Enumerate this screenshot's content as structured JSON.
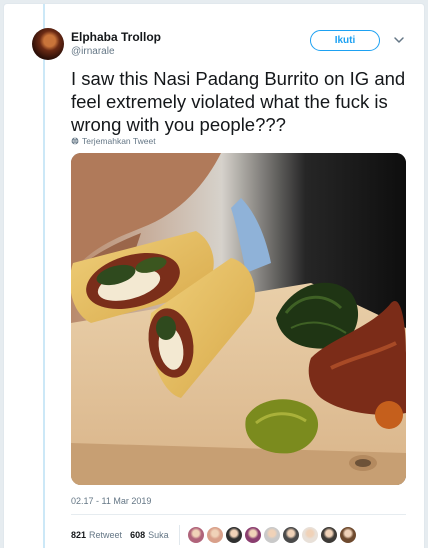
{
  "author": {
    "display_name": "Elphaba Trollop",
    "handle": "@irnarale"
  },
  "follow_button_label": "Ikuti",
  "tweet": {
    "text": "I saw this Nasi Padang Burrito on IG and feel extremely violated what the fuck is wrong with you people???",
    "translate_label": "Terjemahkan Tweet",
    "timestamp": "02.17 - 11 Mar 2019"
  },
  "stats": {
    "retweet_count": "821",
    "retweet_label": "Retweet",
    "like_count": "608",
    "like_label": "Suka"
  },
  "liker_avatar_colors": [
    "#b0637a",
    "#d9a08a",
    "#2f2f2f",
    "#8a3e6f",
    "#c9c9c9",
    "#4a4a4a",
    "#e8e0d8",
    "#3d3a36",
    "#6e4a2e"
  ],
  "colors": {
    "accent": "#1da1f2",
    "thread_line": "#cce8f7"
  }
}
